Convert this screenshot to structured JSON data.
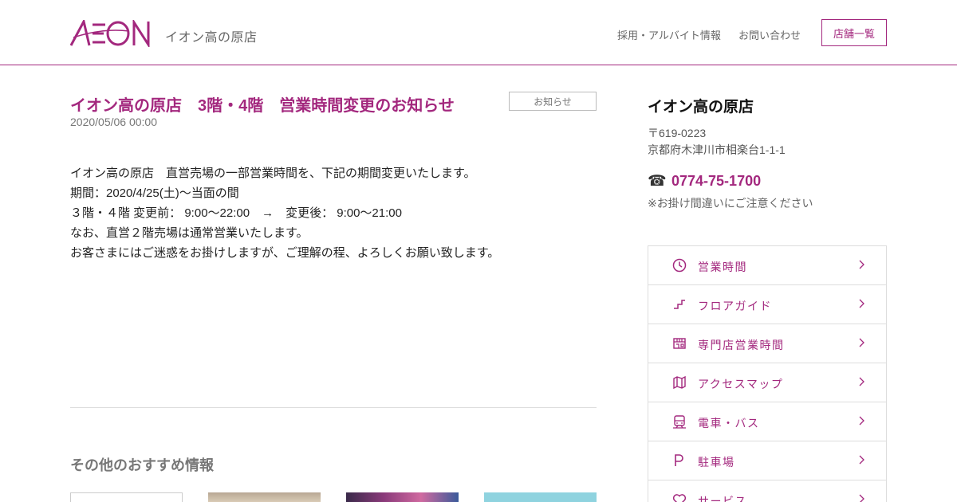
{
  "header": {
    "logo_text": "AEON",
    "store_name": "イオン高の原店",
    "nav": {
      "recruit": "採用・アルバイト情報",
      "contact": "お問い合わせ",
      "store_list": "店舗一覧"
    }
  },
  "article": {
    "title": "イオン高の原店　3階・4階　営業時間変更のお知らせ",
    "category": "お知らせ",
    "date": "2020/05/06 00:00",
    "body_lines": [
      "イオン高の原店　直営売場の一部営業時間を、下記の期間変更いたします。",
      "期間：2020/4/25(土)～当面の間",
      "３階・４階 変更前： 9:00～22:00　→　変更後： 9:00～21:00",
      "なお、直営２階売場は通常営業いたします。",
      "お客さまにはご迷惑をお掛けしますが、ご理解の程、よろしくお願い致します。"
    ]
  },
  "recommend": {
    "heading": "その他のおすすめ情報"
  },
  "sidebar": {
    "store_name": "イオン高の原店",
    "postal": "〒619-0223",
    "address": "京都府木津川市相楽台1-1-1",
    "phone_icon": "phone-icon",
    "phone": "0774-75-1700",
    "phone_note": "※お掛け間違いにご注意ください",
    "menu": [
      {
        "label": "営業時間",
        "icon": "clock-icon"
      },
      {
        "label": "フロアガイド",
        "icon": "stairs-icon"
      },
      {
        "label": "専門店営業時間",
        "icon": "storefront-icon"
      },
      {
        "label": "アクセスマップ",
        "icon": "map-icon"
      },
      {
        "label": "電車・バス",
        "icon": "train-icon"
      },
      {
        "label": "駐車場",
        "icon": "parking-icon"
      },
      {
        "label": "サービス",
        "icon": "heart-icon"
      }
    ]
  },
  "colors": {
    "brand": "#a3287e",
    "text": "#333333",
    "border": "#dddddd"
  }
}
